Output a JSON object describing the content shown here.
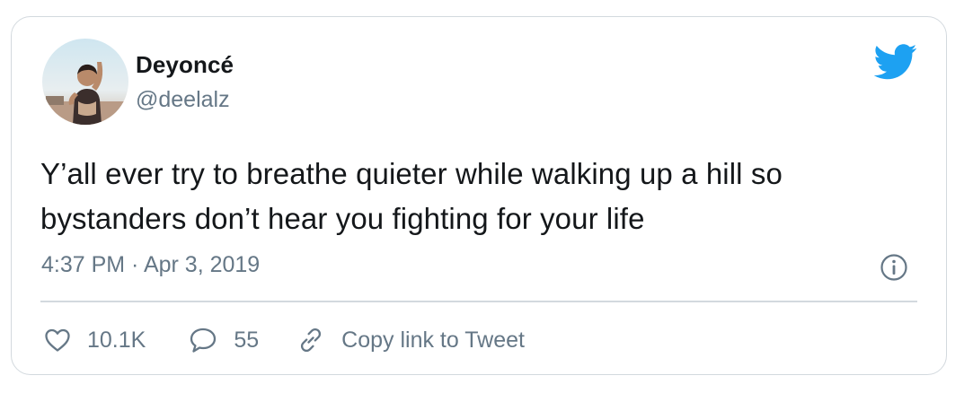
{
  "tweet": {
    "author": {
      "display_name": "Deyoncé",
      "handle": "@deelalz",
      "avatar_icon": "profile-photo"
    },
    "text": "Y’all ever try to breathe quieter while walking up a hill so bystanders don’t hear you fighting for your life",
    "timestamp": "4:37 PM · Apr 3, 2019",
    "actions": {
      "likes": "10.1K",
      "replies": "55",
      "copy_link_label": "Copy link to Tweet"
    }
  },
  "icons": {
    "brand": "twitter-bird-icon",
    "info": "info-icon",
    "like": "heart-icon",
    "reply": "speech-bubble-icon",
    "link": "link-icon"
  },
  "colors": {
    "brand_blue": "#1da1f2",
    "text_primary": "#14171a",
    "text_secondary": "#657786",
    "border": "#d3d9de"
  }
}
